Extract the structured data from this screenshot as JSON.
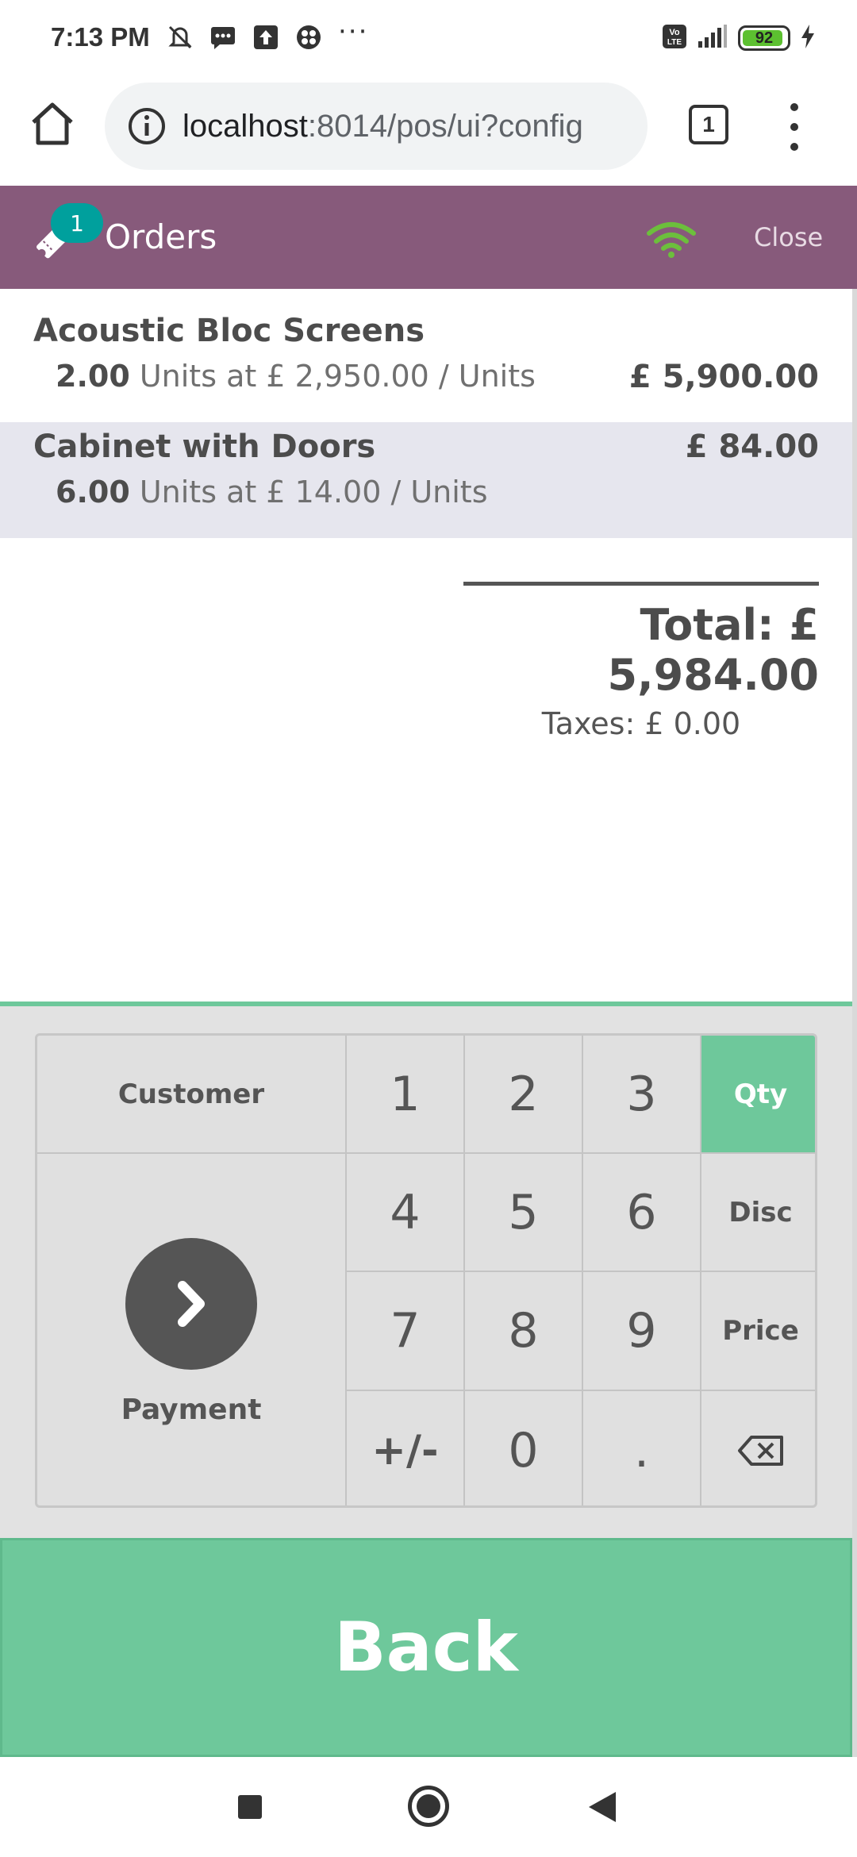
{
  "status_bar": {
    "time": "7:13 PM",
    "left_icons": [
      "mute-icon",
      "message-icon",
      "upload-icon",
      "app-icon"
    ],
    "more": "···",
    "network_badge": "Vo LTE",
    "battery_percent": 92,
    "battery_label": "92",
    "charging": true
  },
  "browser": {
    "url_host": "localhost",
    "url_rest": ":8014/pos/ui?config",
    "tab_count": "1"
  },
  "pos_header": {
    "orders_badge": "1",
    "orders_label": "Orders",
    "close_label": "Close",
    "colors": {
      "header": "#875a7b",
      "badge": "#00a09d",
      "wifi": "#6ec89b"
    }
  },
  "orderlines": [
    {
      "name": "Acoustic Bloc Screens",
      "qty": "2.00",
      "info": " Units at £ 2,950.00 / Units",
      "price": "£ 5,900.00",
      "selected": false
    },
    {
      "name": "Cabinet with Doors",
      "qty": "6.00",
      "info": " Units at £ 14.00 / Units",
      "price": "£ 84.00",
      "selected": true
    }
  ],
  "summary": {
    "total": "Total: £ 5,984.00",
    "taxes": "Taxes: £ 0.00"
  },
  "pads": {
    "customer": "Customer",
    "payment": "Payment",
    "digits": [
      "1",
      "2",
      "3",
      "4",
      "5",
      "6",
      "7",
      "8",
      "9",
      "+/-",
      "0",
      "."
    ],
    "modes": {
      "qty": "Qty",
      "disc": "Disc",
      "price": "Price"
    },
    "active_mode": "Qty",
    "accent": "#6ec89b"
  },
  "back_label": "Back"
}
